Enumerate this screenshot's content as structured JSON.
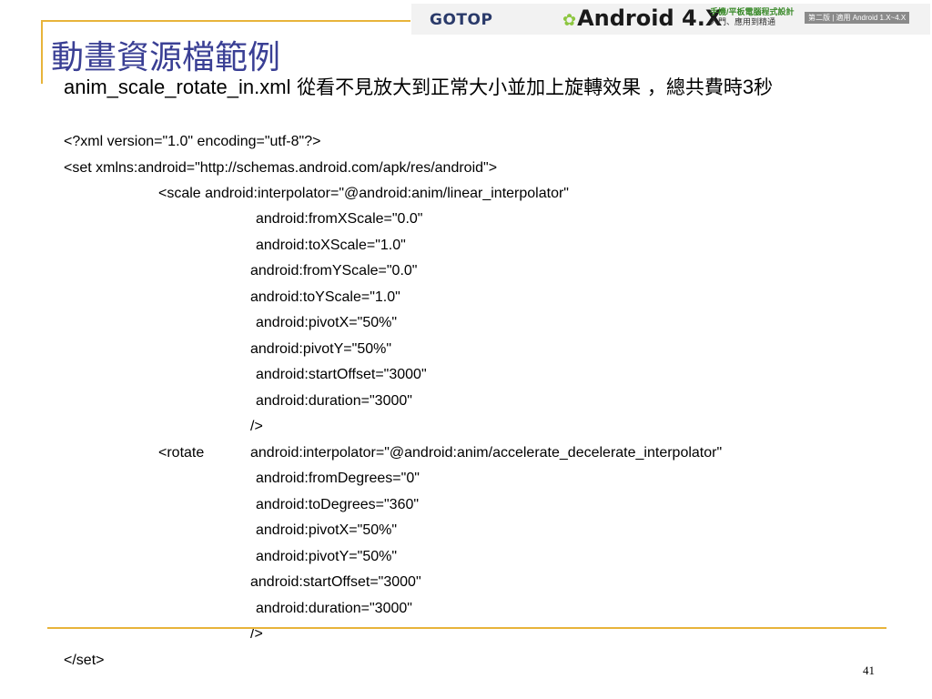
{
  "header": {
    "brand_gotop": "GOTOP",
    "brand_android": "Android 4.X",
    "brand_sub_line1": "手機/平板電腦程式設計",
    "brand_sub_line2": "入門、應用到精通",
    "brand_edition": "第二版 | 適用 Android 1.X~4.X"
  },
  "title": "動畫資源檔範例",
  "subtitle": {
    "filename": "anim_scale_rotate_in.xml",
    "desc": " 從看不見放大到正常大小並加上旋轉效果 ，總共費時",
    "number": "3",
    "unit": "秒"
  },
  "code": [
    "<?xml version=\"1.0\" encoding=\"utf-8\"?>",
    "<set xmlns:android=\"http://schemas.android.com/apk/res/android\">",
    "<scale android:interpolator=\"@android:anim/linear_interpolator\"",
    "android:fromXScale=\"0.0\"",
    "android:toXScale=\"1.0\"",
    "android:fromYScale=\"0.0\"",
    "android:toYScale=\"1.0\"",
    "android:pivotX=\"50%\"",
    "android:pivotY=\"50%\"",
    "android:startOffset=\"3000\"",
    "android:duration=\"3000\"",
    "/>",
    "<rotate",
    "android:interpolator=\"@android:anim/accelerate_decelerate_interpolator\"",
    "android:fromDegrees=\"0\"",
    "android:toDegrees=\"360\"",
    "android:pivotX=\"50%\"",
    "android:pivotY=\"50%\"",
    "android:startOffset=\"3000\"",
    "android:duration=\"3000\"",
    "/>",
    "</set>"
  ],
  "page_number": "41"
}
